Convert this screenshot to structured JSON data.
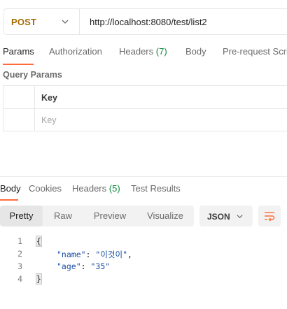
{
  "request": {
    "method": "POST",
    "url": "http://localhost:8080/test/list2"
  },
  "request_tabs": [
    {
      "label": "Params",
      "count": ""
    },
    {
      "label": "Authorization",
      "count": ""
    },
    {
      "label": "Headers",
      "count": "(7)"
    },
    {
      "label": "Body",
      "count": ""
    },
    {
      "label": "Pre-request Scri",
      "count": ""
    }
  ],
  "query_params": {
    "title": "Query Params",
    "key_header": "Key",
    "key_placeholder": "Key"
  },
  "response_tabs": [
    {
      "label": "Body",
      "count": ""
    },
    {
      "label": "Cookies",
      "count": ""
    },
    {
      "label": "Headers",
      "count": "(5)"
    },
    {
      "label": "Test Results",
      "count": ""
    }
  ],
  "view_modes": [
    "Pretty",
    "Raw",
    "Preview",
    "Visualize"
  ],
  "format": "JSON",
  "code": {
    "line_numbers": [
      "1",
      "2",
      "3",
      "4"
    ],
    "open_brace": "{",
    "close_brace": "}",
    "name_key": "\"name\"",
    "name_value": "\"이것이\"",
    "age_key": "\"age\"",
    "age_value": "\"35\""
  },
  "colors": {
    "accent": "#ff6c37",
    "method": "#a56b00",
    "count": "#0a8a3a",
    "json_string": "#1b4fa3"
  }
}
